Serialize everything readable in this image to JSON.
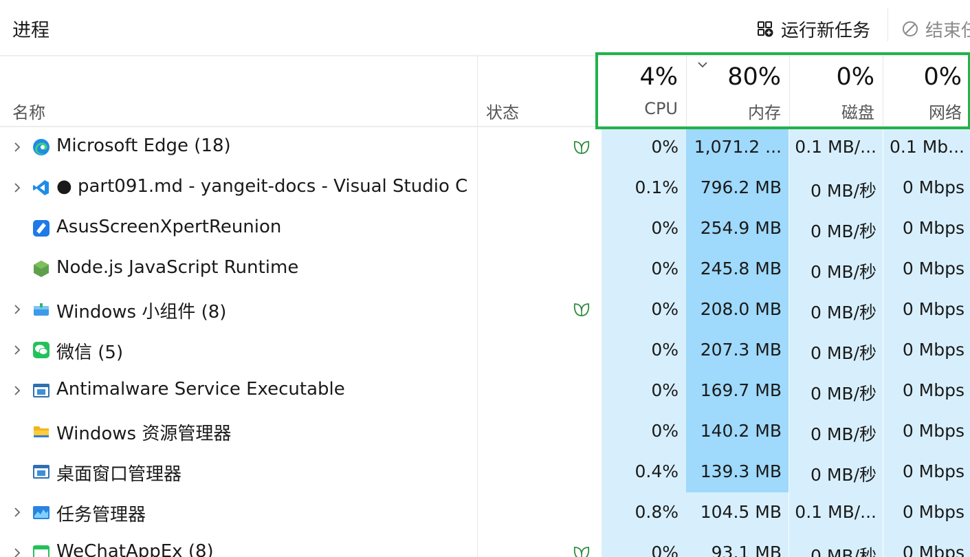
{
  "toolbar": {
    "title": "进程",
    "run_new_task": "运行新任务",
    "end_task": "结束任"
  },
  "header": {
    "name": "名称",
    "status": "状态",
    "cpu": {
      "pct": "4%",
      "label": "CPU"
    },
    "memory": {
      "pct": "80%",
      "label": "内存"
    },
    "disk": {
      "pct": "0%",
      "label": "磁盘"
    },
    "network": {
      "pct": "0%",
      "label": "网络"
    }
  },
  "rows": [
    {
      "name": "Microsoft Edge (18)",
      "icon": "edge-icon",
      "expandable": true,
      "eco": true,
      "cpu": "0%",
      "mem": "1,071.2 ...",
      "disk": "0.1 MB/...",
      "net": "0.1 Mb..."
    },
    {
      "name": "● part091.md - yangeit-docs - Visual Studio C...",
      "icon": "vscode-icon",
      "expandable": true,
      "eco": false,
      "cpu": "0.1%",
      "mem": "796.2 MB",
      "disk": "0 MB/秒",
      "net": "0 Mbps"
    },
    {
      "name": "AsusScreenXpertReunion",
      "icon": "asus-icon",
      "expandable": false,
      "eco": false,
      "cpu": "0%",
      "mem": "254.9 MB",
      "disk": "0 MB/秒",
      "net": "0 Mbps"
    },
    {
      "name": "Node.js JavaScript Runtime",
      "icon": "nodejs-icon",
      "expandable": false,
      "eco": false,
      "cpu": "0%",
      "mem": "245.8 MB",
      "disk": "0 MB/秒",
      "net": "0 Mbps"
    },
    {
      "name": "Windows 小组件 (8)",
      "icon": "widgets-icon",
      "expandable": true,
      "eco": true,
      "cpu": "0%",
      "mem": "208.0 MB",
      "disk": "0 MB/秒",
      "net": "0 Mbps"
    },
    {
      "name": "微信 (5)",
      "icon": "wechat-icon",
      "expandable": true,
      "eco": false,
      "cpu": "0%",
      "mem": "207.3 MB",
      "disk": "0 MB/秒",
      "net": "0 Mbps"
    },
    {
      "name": "Antimalware Service Executable",
      "icon": "window-app-icon",
      "expandable": true,
      "eco": false,
      "cpu": "0%",
      "mem": "169.7 MB",
      "disk": "0 MB/秒",
      "net": "0 Mbps"
    },
    {
      "name": "Windows 资源管理器",
      "icon": "folder-icon",
      "expandable": false,
      "eco": false,
      "cpu": "0%",
      "mem": "140.2 MB",
      "disk": "0 MB/秒",
      "net": "0 Mbps"
    },
    {
      "name": "桌面窗口管理器",
      "icon": "window-app-icon",
      "expandable": false,
      "eco": false,
      "cpu": "0.4%",
      "mem": "139.3 MB",
      "disk": "0 MB/秒",
      "net": "0 Mbps"
    },
    {
      "name": "任务管理器",
      "icon": "taskmgr-icon",
      "expandable": true,
      "eco": false,
      "cpu": "0.8%",
      "mem": "104.5 MB",
      "disk": "0.1 MB/...",
      "net": "0 Mbps"
    },
    {
      "name": "WeChatAppEx (8)",
      "icon": "wechatapp-icon",
      "expandable": true,
      "eco": true,
      "cpu": "0%",
      "mem": "93.1 MB",
      "disk": "0 MB/秒",
      "net": "0 Mbps"
    }
  ],
  "colors": {
    "highlight": "#22b14c",
    "heat_light": "#d7effc",
    "heat_strong": "#9fd9fb"
  }
}
